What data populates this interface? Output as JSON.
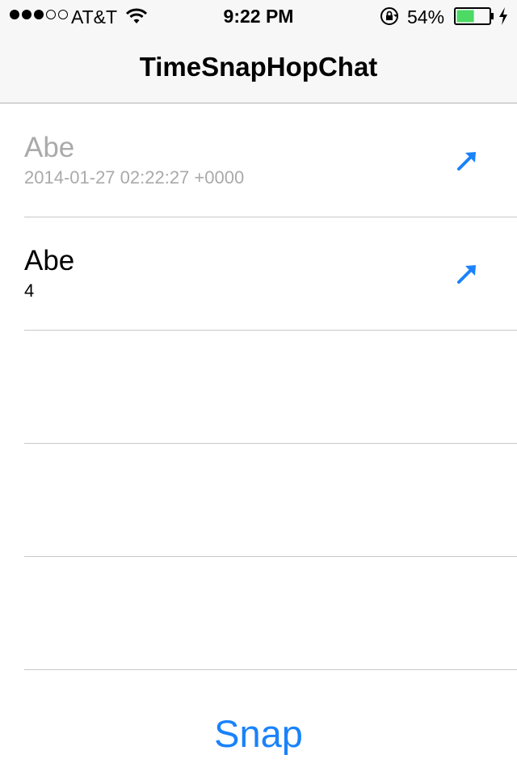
{
  "status_bar": {
    "carrier": "AT&T",
    "time": "9:22 PM",
    "battery_percent": "54%",
    "battery_level": 0.54,
    "battery_color": "#4cd964",
    "signal_bars_filled": 3,
    "signal_bars_total": 5,
    "icons": [
      "wifi-icon",
      "orientation-lock-icon",
      "battery-icon",
      "charging-bolt-icon"
    ]
  },
  "nav": {
    "title": "TimeSnapHopChat"
  },
  "rows": [
    {
      "title": "Abe",
      "subtitle": "2014-01-27 02:22:27 +0000",
      "icon": "arrow-up-right-icon"
    },
    {
      "title": "Abe",
      "subtitle": "4",
      "icon": "arrow-up-right-icon"
    }
  ],
  "snap_button": {
    "label": "Snap"
  },
  "colors": {
    "accent": "#1a82fb",
    "dimmed_text": "#aaaaaa",
    "separator": "#c8c7cc",
    "bar_background": "#f7f7f7"
  }
}
